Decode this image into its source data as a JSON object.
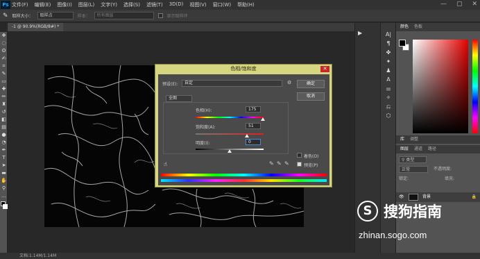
{
  "app": {
    "logo": "Ps"
  },
  "menu": [
    "文件(F)",
    "编辑(E)",
    "图像(I)",
    "图层(L)",
    "文字(Y)",
    "选择(S)",
    "滤镜(T)",
    "3D(D)",
    "视图(V)",
    "窗口(W)",
    "帮助(H)"
  ],
  "window_controls": [
    "—",
    "▢",
    "✕"
  ],
  "options_bar": {
    "sample_size_label": "取样大小：",
    "sample_size_value": "取样点",
    "sample_label": "样本：",
    "sample_value": "所有图层",
    "show_ring_label": "显示取样环"
  },
  "document_tab": "-1 @ 90.9%(RGB/8#) *",
  "status_bar": "文档:1.14M/1.14M",
  "dialog": {
    "title": "色相/饱和度",
    "preset_label": "预设(E):",
    "preset_value": "自定",
    "channel_value": "全图",
    "hue_label": "色相(H):",
    "hue_value": "175",
    "hue_level": 0.986,
    "saturation_label": "饱和度(A):",
    "saturation_value": "51",
    "saturation_level": 0.755,
    "lightness_label": "明度(I):",
    "lightness_value": "0",
    "lightness_level": 0.5,
    "ok_label": "确定",
    "cancel_label": "取消",
    "colorize_label": "着色(O)",
    "preview_label": "预览(P)"
  },
  "panels": {
    "color_tab": "颜色",
    "swatches_tab": "色板",
    "tab1": "库",
    "tab2": "调整",
    "layers_tab": "图层",
    "channels_tab": "通道",
    "paths_tab": "路径",
    "kind_label": "类型",
    "blend_mode": "正常",
    "opacity_label": "不透明度:",
    "lock_label": "锁定:",
    "fill_label": "填充:",
    "layer_name": "背景"
  },
  "watermark": {
    "logo_char": "S",
    "title": "搜狗指南",
    "url": "zhinan.sogo.com"
  }
}
